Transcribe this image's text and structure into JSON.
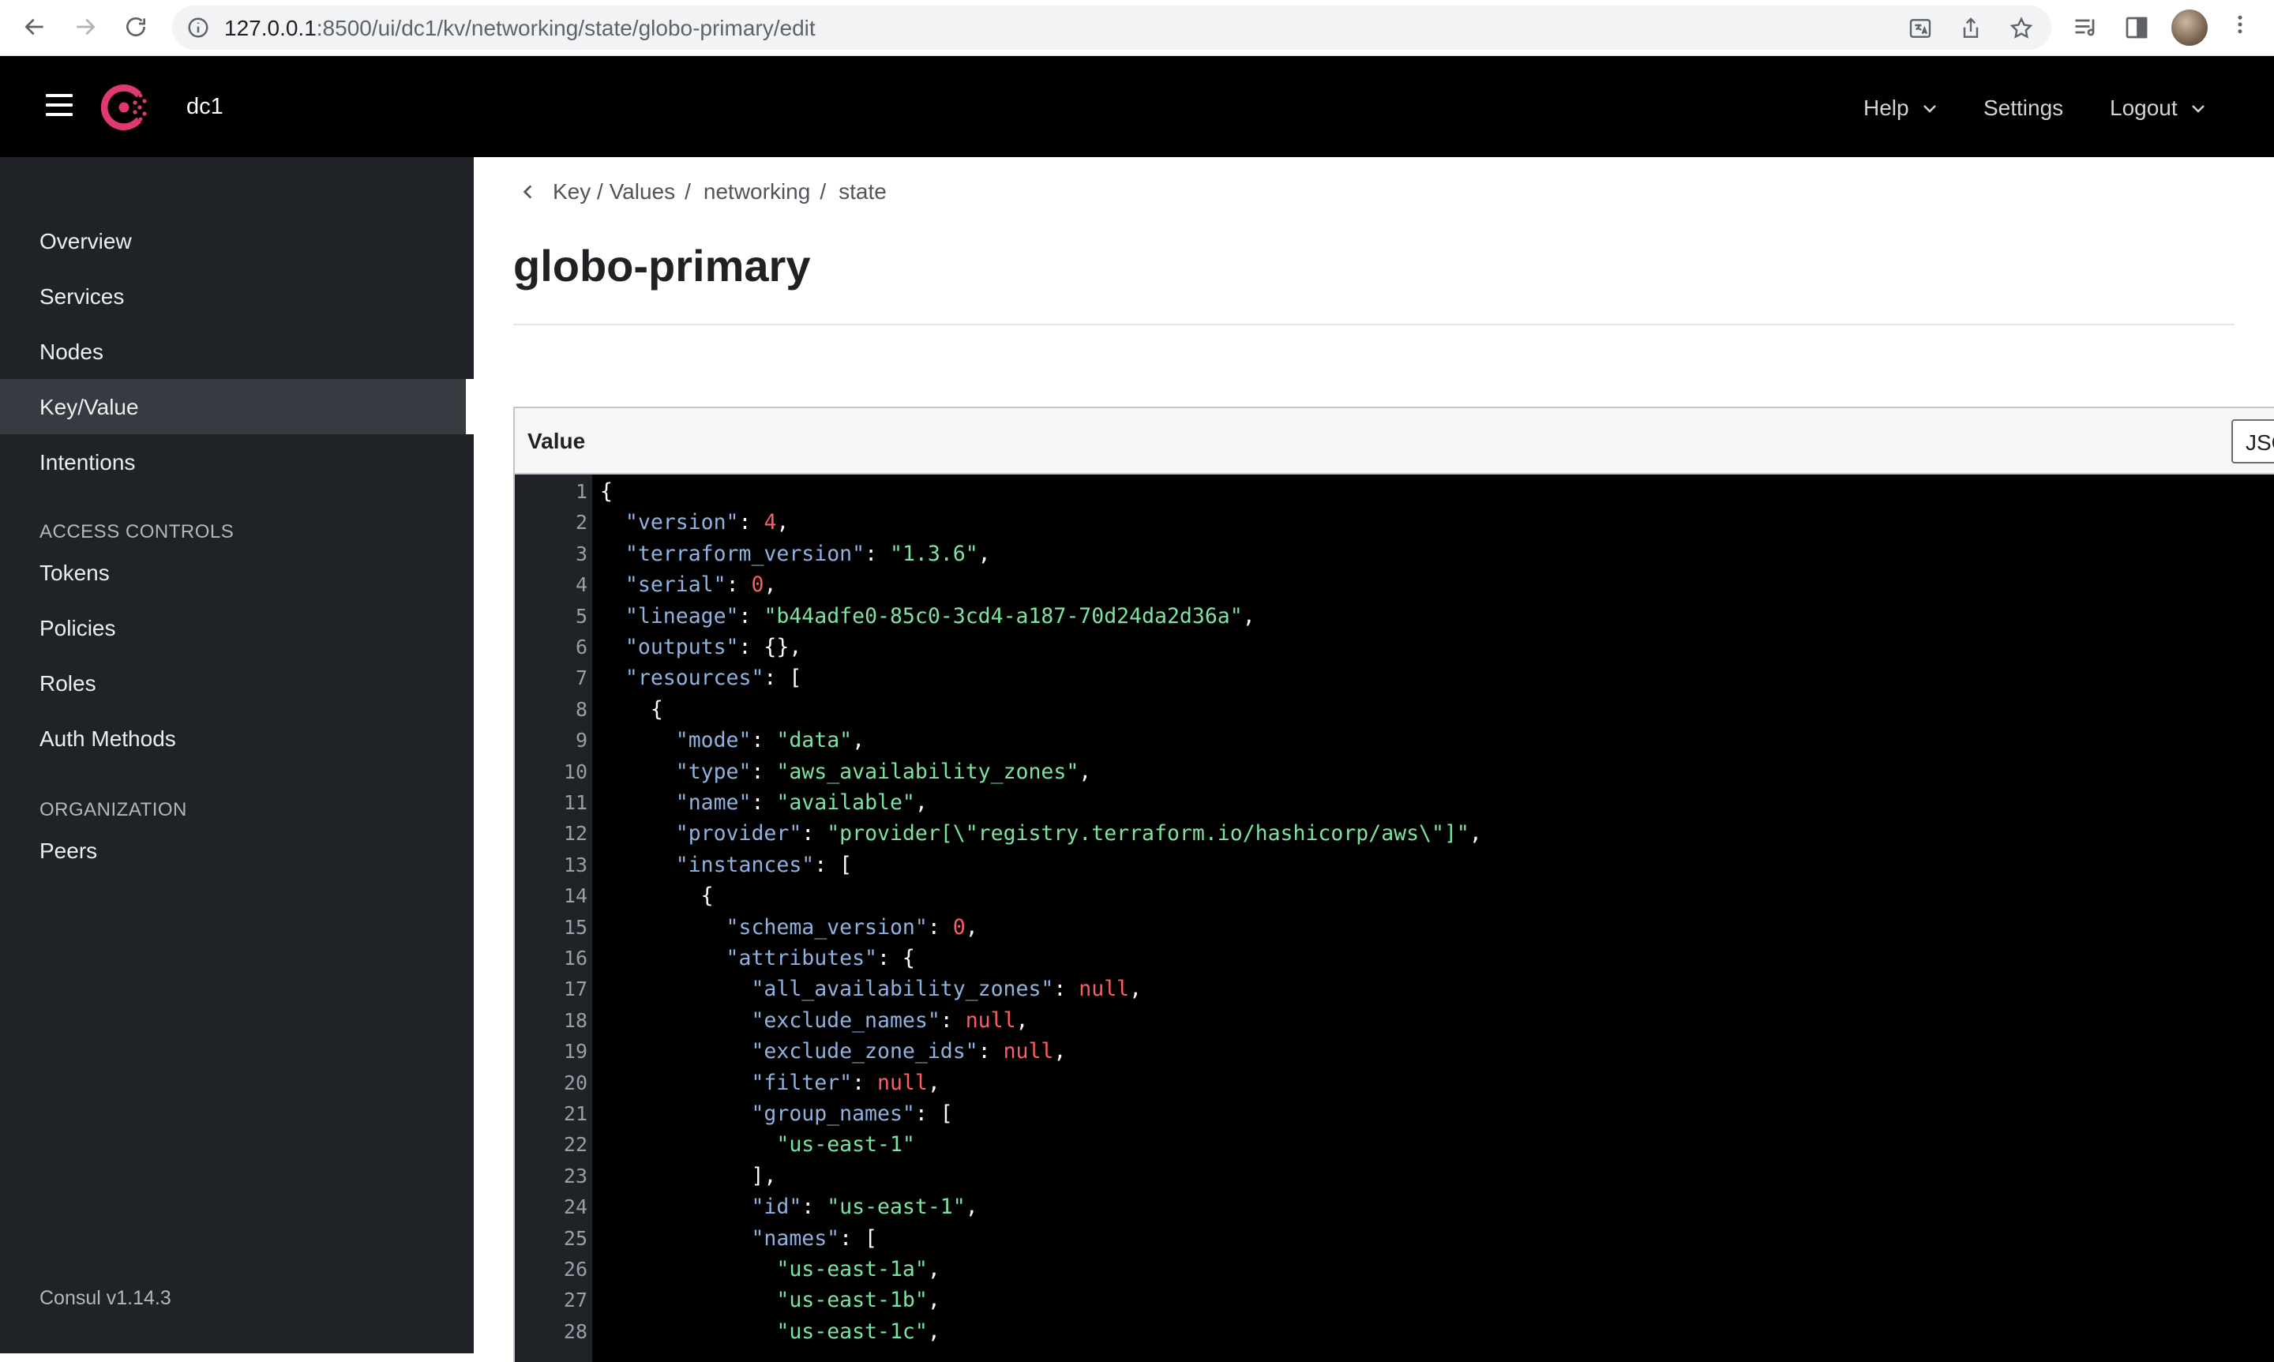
{
  "browser": {
    "url_host": "127.0.0.1",
    "url_rest": ":8500/ui/dc1/kv/networking/state/globo-primary/edit"
  },
  "header": {
    "datacenter": "dc1",
    "help_label": "Help",
    "settings_label": "Settings",
    "logout_label": "Logout"
  },
  "sidebar": {
    "items": [
      "Overview",
      "Services",
      "Nodes",
      "Key/Value",
      "Intentions"
    ],
    "access_heading": "ACCESS CONTROLS",
    "access_items": [
      "Tokens",
      "Policies",
      "Roles",
      "Auth Methods"
    ],
    "org_heading": "ORGANIZATION",
    "org_items": [
      "Peers"
    ],
    "version": "Consul v1.14.3",
    "active_item": "Key/Value"
  },
  "breadcrumb": [
    "Key / Values",
    "networking",
    "state"
  ],
  "page": {
    "title": "globo-primary"
  },
  "editor": {
    "label": "Value",
    "mode": "JSON",
    "lines": [
      [
        [
          "p",
          "{"
        ]
      ],
      [
        [
          "p",
          "  "
        ],
        [
          "k",
          "\"version\""
        ],
        [
          "p",
          ": "
        ],
        [
          "n",
          "4"
        ],
        [
          "p",
          ","
        ]
      ],
      [
        [
          "p",
          "  "
        ],
        [
          "k",
          "\"terraform_version\""
        ],
        [
          "p",
          ": "
        ],
        [
          "s",
          "\"1.3.6\""
        ],
        [
          "p",
          ","
        ]
      ],
      [
        [
          "p",
          "  "
        ],
        [
          "k",
          "\"serial\""
        ],
        [
          "p",
          ": "
        ],
        [
          "n",
          "0"
        ],
        [
          "p",
          ","
        ]
      ],
      [
        [
          "p",
          "  "
        ],
        [
          "k",
          "\"lineage\""
        ],
        [
          "p",
          ": "
        ],
        [
          "s",
          "\"b44adfe0-85c0-3cd4-a187-70d24da2d36a\""
        ],
        [
          "p",
          ","
        ]
      ],
      [
        [
          "p",
          "  "
        ],
        [
          "k",
          "\"outputs\""
        ],
        [
          "p",
          ": {},"
        ]
      ],
      [
        [
          "p",
          "  "
        ],
        [
          "k",
          "\"resources\""
        ],
        [
          "p",
          ": ["
        ]
      ],
      [
        [
          "p",
          "    {"
        ]
      ],
      [
        [
          "p",
          "      "
        ],
        [
          "k",
          "\"mode\""
        ],
        [
          "p",
          ": "
        ],
        [
          "s",
          "\"data\""
        ],
        [
          "p",
          ","
        ]
      ],
      [
        [
          "p",
          "      "
        ],
        [
          "k",
          "\"type\""
        ],
        [
          "p",
          ": "
        ],
        [
          "s",
          "\"aws_availability_zones\""
        ],
        [
          "p",
          ","
        ]
      ],
      [
        [
          "p",
          "      "
        ],
        [
          "k",
          "\"name\""
        ],
        [
          "p",
          ": "
        ],
        [
          "s",
          "\"available\""
        ],
        [
          "p",
          ","
        ]
      ],
      [
        [
          "p",
          "      "
        ],
        [
          "k",
          "\"provider\""
        ],
        [
          "p",
          ": "
        ],
        [
          "s",
          "\"provider[\\\"registry.terraform.io/hashicorp/aws\\\"]\""
        ],
        [
          "p",
          ","
        ]
      ],
      [
        [
          "p",
          "      "
        ],
        [
          "k",
          "\"instances\""
        ],
        [
          "p",
          ": ["
        ]
      ],
      [
        [
          "p",
          "        {"
        ]
      ],
      [
        [
          "p",
          "          "
        ],
        [
          "k",
          "\"schema_version\""
        ],
        [
          "p",
          ": "
        ],
        [
          "n",
          "0"
        ],
        [
          "p",
          ","
        ]
      ],
      [
        [
          "p",
          "          "
        ],
        [
          "k",
          "\"attributes\""
        ],
        [
          "p",
          ": {"
        ]
      ],
      [
        [
          "p",
          "            "
        ],
        [
          "k",
          "\"all_availability_zones\""
        ],
        [
          "p",
          ": "
        ],
        [
          "n",
          "null"
        ],
        [
          "p",
          ","
        ]
      ],
      [
        [
          "p",
          "            "
        ],
        [
          "k",
          "\"exclude_names\""
        ],
        [
          "p",
          ": "
        ],
        [
          "n",
          "null"
        ],
        [
          "p",
          ","
        ]
      ],
      [
        [
          "p",
          "            "
        ],
        [
          "k",
          "\"exclude_zone_ids\""
        ],
        [
          "p",
          ": "
        ],
        [
          "n",
          "null"
        ],
        [
          "p",
          ","
        ]
      ],
      [
        [
          "p",
          "            "
        ],
        [
          "k",
          "\"filter\""
        ],
        [
          "p",
          ": "
        ],
        [
          "n",
          "null"
        ],
        [
          "p",
          ","
        ]
      ],
      [
        [
          "p",
          "            "
        ],
        [
          "k",
          "\"group_names\""
        ],
        [
          "p",
          ": ["
        ]
      ],
      [
        [
          "p",
          "              "
        ],
        [
          "s",
          "\"us-east-1\""
        ]
      ],
      [
        [
          "p",
          "            ],"
        ]
      ],
      [
        [
          "p",
          "            "
        ],
        [
          "k",
          "\"id\""
        ],
        [
          "p",
          ": "
        ],
        [
          "s",
          "\"us-east-1\""
        ],
        [
          "p",
          ","
        ]
      ],
      [
        [
          "p",
          "            "
        ],
        [
          "k",
          "\"names\""
        ],
        [
          "p",
          ": ["
        ]
      ],
      [
        [
          "p",
          "              "
        ],
        [
          "s",
          "\"us-east-1a\""
        ],
        [
          "p",
          ","
        ]
      ],
      [
        [
          "p",
          "              "
        ],
        [
          "s",
          "\"us-east-1b\""
        ],
        [
          "p",
          ","
        ]
      ],
      [
        [
          "p",
          "              "
        ],
        [
          "s",
          "\"us-east-1c\""
        ],
        [
          "p",
          ","
        ]
      ]
    ]
  }
}
